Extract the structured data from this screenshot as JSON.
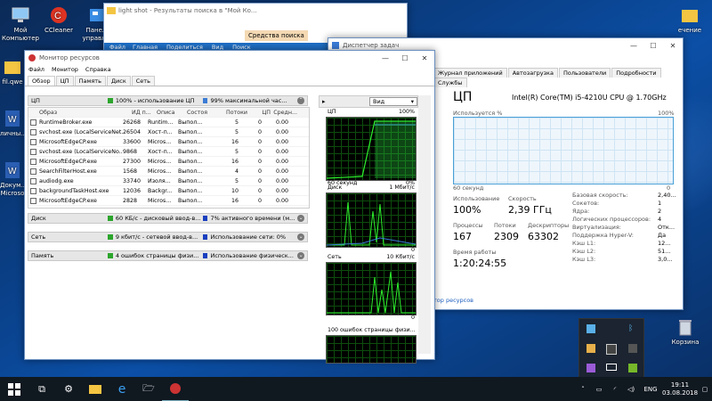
{
  "desktop": {
    "icons": [
      {
        "label": "Мой Компьютер"
      },
      {
        "label": "CCleaner"
      },
      {
        "label": "Панель управлен"
      },
      {
        "label": "fil.qwe"
      },
      {
        "label": "личны..."
      },
      {
        "label": "Докум... Microso"
      },
      {
        "label": "Корзина"
      },
      {
        "label": "ечение"
      }
    ]
  },
  "explorer": {
    "title": "light shot - Результаты поиска в \"Мой Ко...",
    "context_tab": "Средства поиска",
    "ribbon": [
      "Файл",
      "Главная",
      "Поделиться",
      "Вид",
      "Поиск"
    ]
  },
  "resmon": {
    "title": "Монитор ресурсов",
    "menu": [
      "Файл",
      "Монитор",
      "Справка"
    ],
    "tabs": [
      "Обзор",
      "ЦП",
      "Память",
      "Диск",
      "Сеть"
    ],
    "cpu_section": {
      "name": "ЦП",
      "usage": "100% - использование ЦП",
      "max": "99% максимальной час..."
    },
    "columns": [
      "Образ",
      "ИД п...",
      "Описа",
      "Состоя",
      "Потоки",
      "ЦП",
      "Средн..."
    ],
    "rows": [
      [
        "RuntimeBroker.exe",
        "26268",
        "Runtim...",
        "Выпол...",
        "5",
        "0",
        "0.00"
      ],
      [
        "svchost.exe (LocalServiceNet...",
        "26504",
        "Хост-п...",
        "Выпол...",
        "5",
        "0",
        "0.00"
      ],
      [
        "MicrosoftEdgeCP.exe",
        "33600",
        "Micros...",
        "Выпол...",
        "16",
        "0",
        "0.00"
      ],
      [
        "svchost.exe (LocalServiceNo...",
        "9868",
        "Хост-п...",
        "Выпол...",
        "5",
        "0",
        "0.00"
      ],
      [
        "MicrosoftEdgeCP.exe",
        "27300",
        "Micros...",
        "Выпол...",
        "16",
        "0",
        "0.00"
      ],
      [
        "SearchFilterHost.exe",
        "1568",
        "Micros...",
        "Выпол...",
        "4",
        "0",
        "0.00"
      ],
      [
        "audiodg.exe",
        "33740",
        "Изоля...",
        "Выпол...",
        "5",
        "0",
        "0.00"
      ],
      [
        "backgroundTaskHost.exe",
        "12036",
        "Backgr...",
        "Выпол...",
        "10",
        "0",
        "0.00"
      ],
      [
        "MicrosoftEdgeCP.exe",
        "2828",
        "Micros...",
        "Выпол...",
        "16",
        "0",
        "0.00"
      ]
    ],
    "disk": {
      "name": "Диск",
      "a": "60 КБ/с - дисковый ввод-в...",
      "b": "7% активного времени (м..."
    },
    "net": {
      "name": "Сеть",
      "a": "9 кбит/с - сетевой ввод-в...",
      "b": "Использование сети: 0%"
    },
    "mem": {
      "name": "Память",
      "a": "4 ошибок страницы физи...",
      "b": "Использование физическ..."
    },
    "view_label": "Вид",
    "graphs": [
      {
        "title": "ЦП",
        "top": "100%",
        "foot_l": "60 секунд",
        "foot_r": "0%"
      },
      {
        "title": "Диск",
        "top": "1 Мбит/с",
        "foot_r": "0"
      },
      {
        "title": "Сеть",
        "top": "10 Кбит/с",
        "foot_r": "0"
      },
      {
        "title": "100 ошибок страницы физи...",
        "top": ""
      }
    ]
  },
  "taskmgr": {
    "title": "Диспетчер задач",
    "tabs": [
      "Журнал приложений",
      "Автозагрузка",
      "Пользователи",
      "Подробности",
      "Службы"
    ],
    "heading": "ЦП",
    "cpu_name": "Intel(R) Core(TM) i5-4210U CPU @ 1.70GHz",
    "graph_label": "Используется %",
    "graph_top": "100%",
    "graph_foot_l": "60 секунд",
    "graph_foot_r": "0",
    "usage_label": "Использование",
    "usage": "100%",
    "speed_label": "Скорость",
    "speed": "2,39 ГГц",
    "proc_label": "Процессы",
    "proc": "167",
    "threads_label": "Потоки",
    "threads": "2309",
    "handles_label": "Дескрипторы",
    "handles": "63302",
    "uptime_label": "Время работы",
    "uptime": "1:20:24:55",
    "specs": [
      [
        "Базовая скорость:",
        "2,40..."
      ],
      [
        "Сокетов:",
        "1"
      ],
      [
        "Ядра:",
        "2"
      ],
      [
        "Логических процессоров:",
        "4"
      ],
      [
        "Виртуализация:",
        "Отк..."
      ],
      [
        "Поддержка Hyper-V:",
        "Да"
      ],
      [
        "Кэш L1:",
        "12..."
      ],
      [
        "Кэш L2:",
        "51..."
      ],
      [
        "Кэш L3:",
        "3,0..."
      ]
    ],
    "resmon_link": "тор ресурсов"
  },
  "taskbar": {
    "lang": "ENG",
    "time": "19:11",
    "date": "03.08.2018"
  }
}
